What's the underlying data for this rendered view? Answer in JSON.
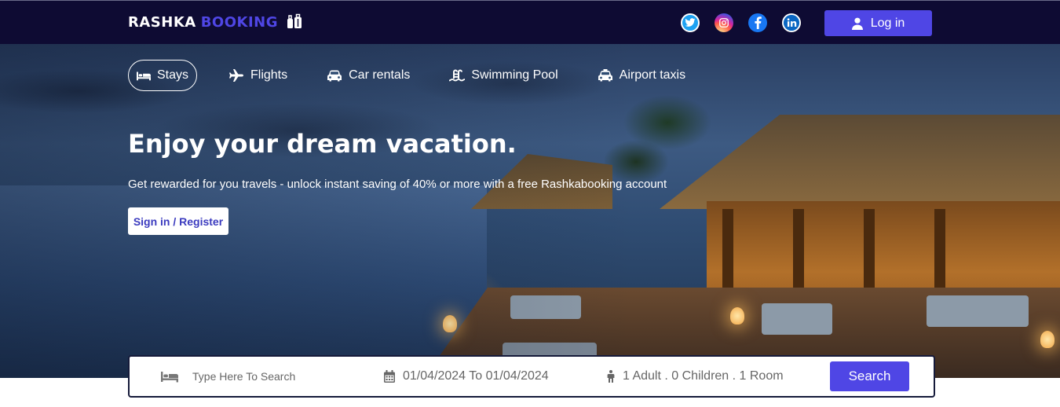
{
  "brand": {
    "part1": "RASHKA",
    "part2": "BOOKING",
    "icon": "luggage-icon"
  },
  "header": {
    "socials": [
      {
        "name": "twitter",
        "icon": "twitter-icon",
        "glyph": "t"
      },
      {
        "name": "instagram",
        "icon": "instagram-icon",
        "glyph": "◎"
      },
      {
        "name": "facebook",
        "icon": "facebook-icon",
        "glyph": "f"
      },
      {
        "name": "linkedin",
        "icon": "linkedin-icon",
        "glyph": "in"
      }
    ],
    "login_label": "Log in",
    "login_icon": "user-icon"
  },
  "tabs": [
    {
      "label": "Stays",
      "icon": "bed-icon",
      "active": true
    },
    {
      "label": "Flights",
      "icon": "plane-icon",
      "active": false
    },
    {
      "label": "Car rentals",
      "icon": "car-icon",
      "active": false
    },
    {
      "label": "Swimming Pool",
      "icon": "pool-ladder-icon",
      "active": false
    },
    {
      "label": "Airport taxis",
      "icon": "taxi-icon",
      "active": false
    }
  ],
  "hero": {
    "title": "Enjoy your dream vacation.",
    "subtitle": "Get rewarded for you travels - unlock instant saving of 40% or more with a free Rashkabooking account",
    "cta_label": "Sign in / Register"
  },
  "search": {
    "placeholder": "Type Here To Search",
    "value": "",
    "date_range": "01/04/2024 To 01/04/2024",
    "guests": "1 Adult . 0 Children . 1 Room",
    "button_label": "Search"
  },
  "colors": {
    "navbar": "#0e0b33",
    "accent": "#4f46e5",
    "white": "#ffffff"
  }
}
